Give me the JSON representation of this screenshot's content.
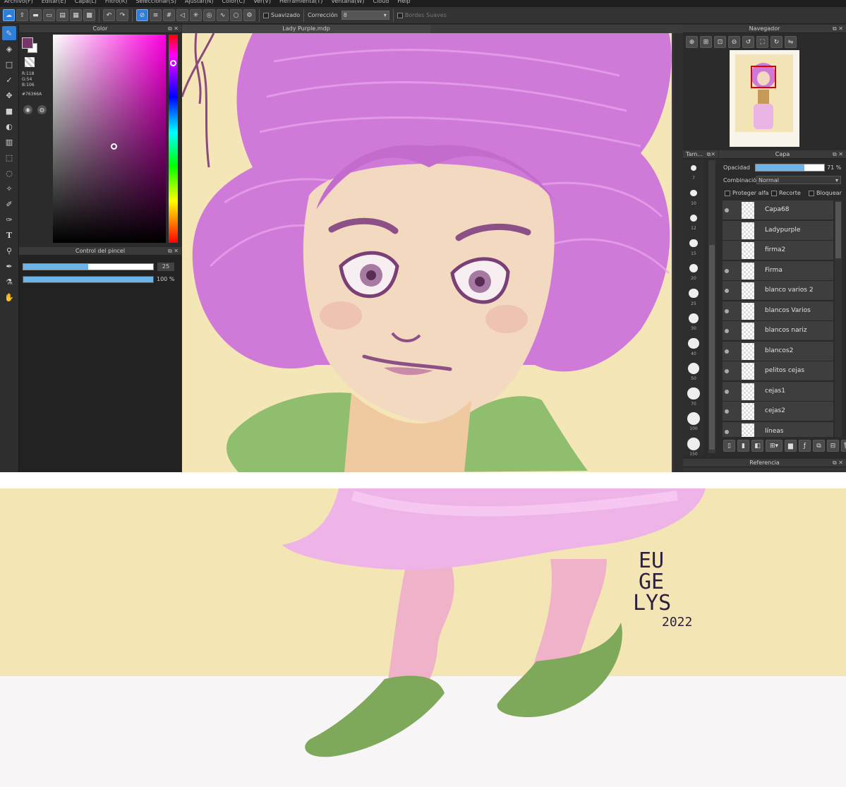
{
  "menu": [
    "Archivo(F)",
    "Editar(E)",
    "Capa(L)",
    "Filtro(R)",
    "Seleccionar(S)",
    "Ajustar(N)",
    "Color(C)",
    "Ver(V)",
    "Herramienta(T)",
    "Ventana(W)",
    "Cloud",
    "Help"
  ],
  "toolbar": {
    "smoothing_label": "Suavizado",
    "correction_label": "Corrección",
    "correction_value": "8",
    "soft_edges_label": "Bordes Suaves"
  },
  "color_panel": {
    "title": "Color",
    "r": "R:118",
    "g": "G:54",
    "b": "B:106",
    "hex": "#76366A",
    "foreground": "#76366A"
  },
  "brush_control": {
    "title": "Control del pincel",
    "size": "25",
    "size_fraction": 0.5,
    "opacity": "100 %",
    "opacity_fraction": 1.0
  },
  "document": {
    "title": "Lady Purple.mdp"
  },
  "navigator": {
    "title": "Navegador"
  },
  "brush_sizes": {
    "title": "Tam...",
    "sizes": [
      "7",
      "10",
      "12",
      "15",
      "20",
      "25",
      "30",
      "40",
      "50",
      "70",
      "100",
      "150"
    ]
  },
  "layers": {
    "title": "Capa",
    "opacity_label": "Opacidad",
    "opacity_value": "71 %",
    "opacity_fraction": 0.71,
    "blend_label": "Combinación",
    "blend_value": "Normal",
    "protect_alpha": "Proteger alfa",
    "clipping": "Recorte",
    "lock": "Bloquear",
    "items": [
      {
        "name": "Capa68",
        "visible": true
      },
      {
        "name": "Ladypurple",
        "visible": false
      },
      {
        "name": "firma2",
        "visible": false
      },
      {
        "name": "Firma",
        "visible": true
      },
      {
        "name": "blanco varios 2",
        "visible": true
      },
      {
        "name": "blancos Varios",
        "visible": true
      },
      {
        "name": "blancos nariz",
        "visible": true
      },
      {
        "name": "blancos2",
        "visible": true
      },
      {
        "name": "pelitos cejas",
        "visible": true
      },
      {
        "name": "cejas1",
        "visible": true
      },
      {
        "name": "cejas2",
        "visible": true
      },
      {
        "name": "líneas",
        "visible": true
      }
    ]
  },
  "reference": {
    "title": "Referencia"
  },
  "signature": {
    "line1": "EU",
    "line2": "GE",
    "line3": "LYS",
    "year": "2022"
  }
}
